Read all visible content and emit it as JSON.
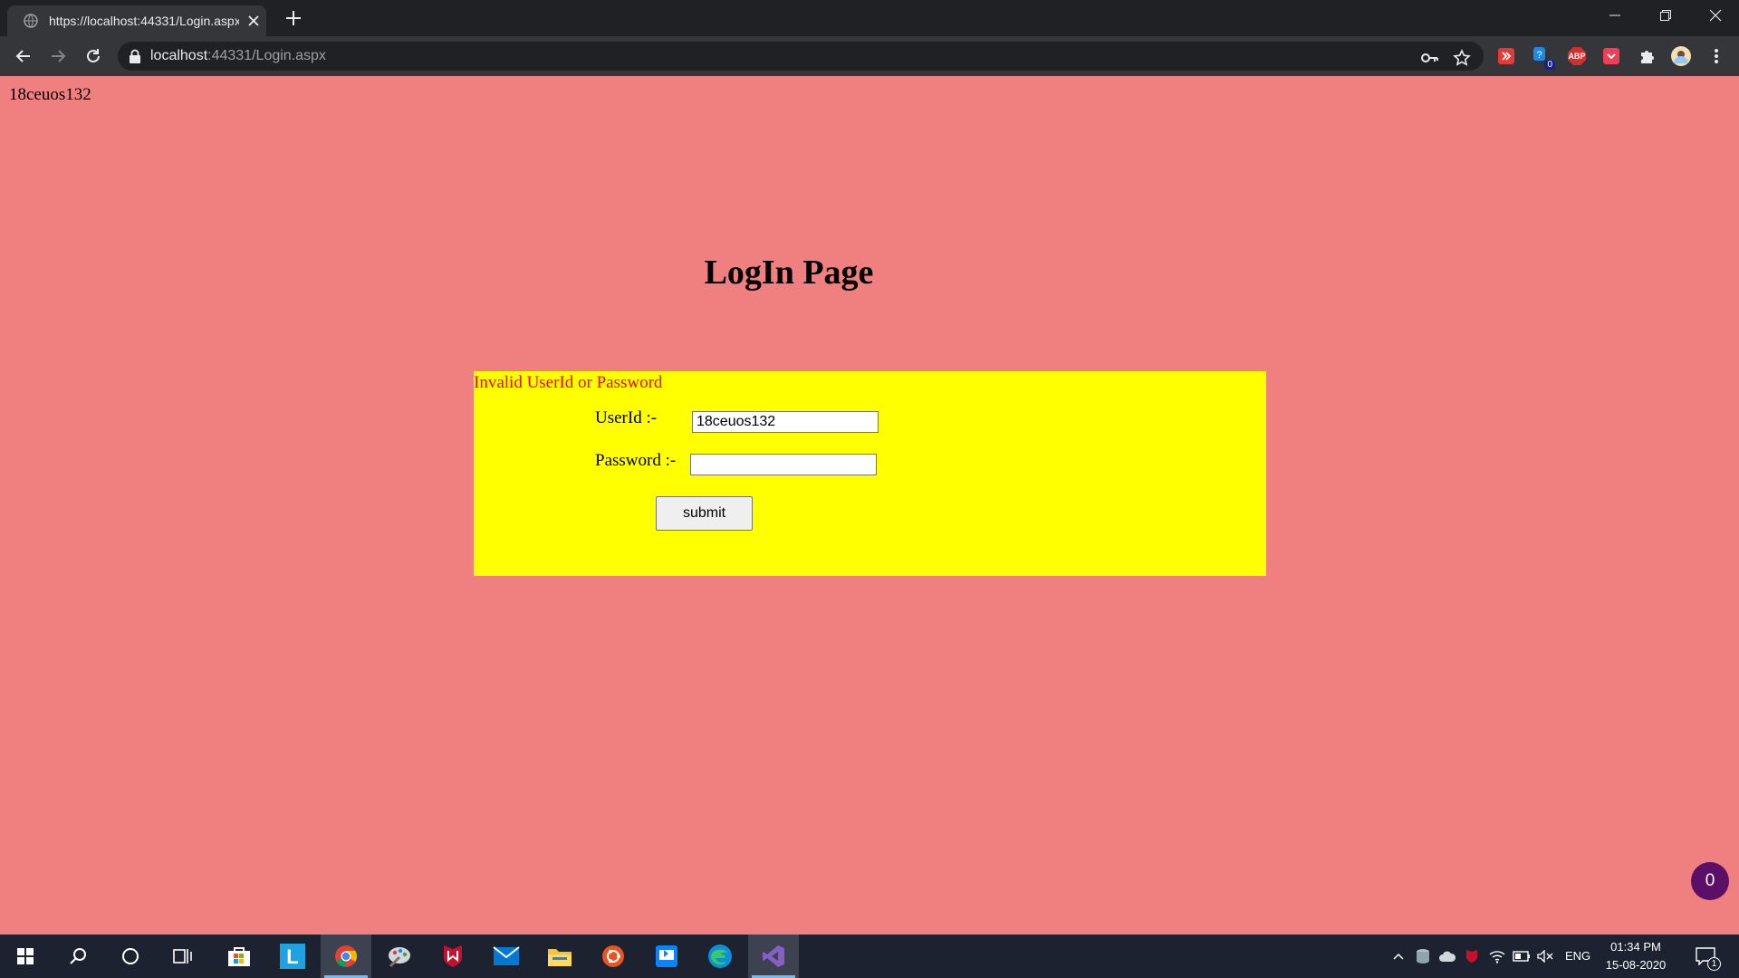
{
  "browser": {
    "tab_title": "https://localhost:44331/Login.aspx",
    "url_host": "localhost",
    "url_path": ":44331/Login.aspx",
    "extension_badge_count": "0",
    "extension_abp_label": "ABP"
  },
  "page": {
    "session_user": "18ceuos132",
    "title": "LogIn Page",
    "error_message": "Invalid UserId or Password",
    "userid_label": "UserId :-",
    "userid_value": "18ceuos132",
    "password_label": "Password :-",
    "password_value": "",
    "submit_label": "submit",
    "floating_badge": "0",
    "colors": {
      "background": "#f08080",
      "form_background": "#ffff00",
      "error": "#ff0000"
    }
  },
  "taskbar": {
    "apps": [
      "start-icon",
      "search-icon",
      "cortana-icon",
      "task-view-icon",
      "store-icon",
      "l-app-icon",
      "chrome-icon",
      "paint-icon",
      "mcafee-icon",
      "mail-icon",
      "file-explorer-icon",
      "ubuntu-icon",
      "remote-app-icon",
      "edge-icon",
      "visual-studio-icon"
    ],
    "language": "ENG",
    "time": "01:34 PM",
    "date": "15-08-2020",
    "notification_count": "1"
  }
}
